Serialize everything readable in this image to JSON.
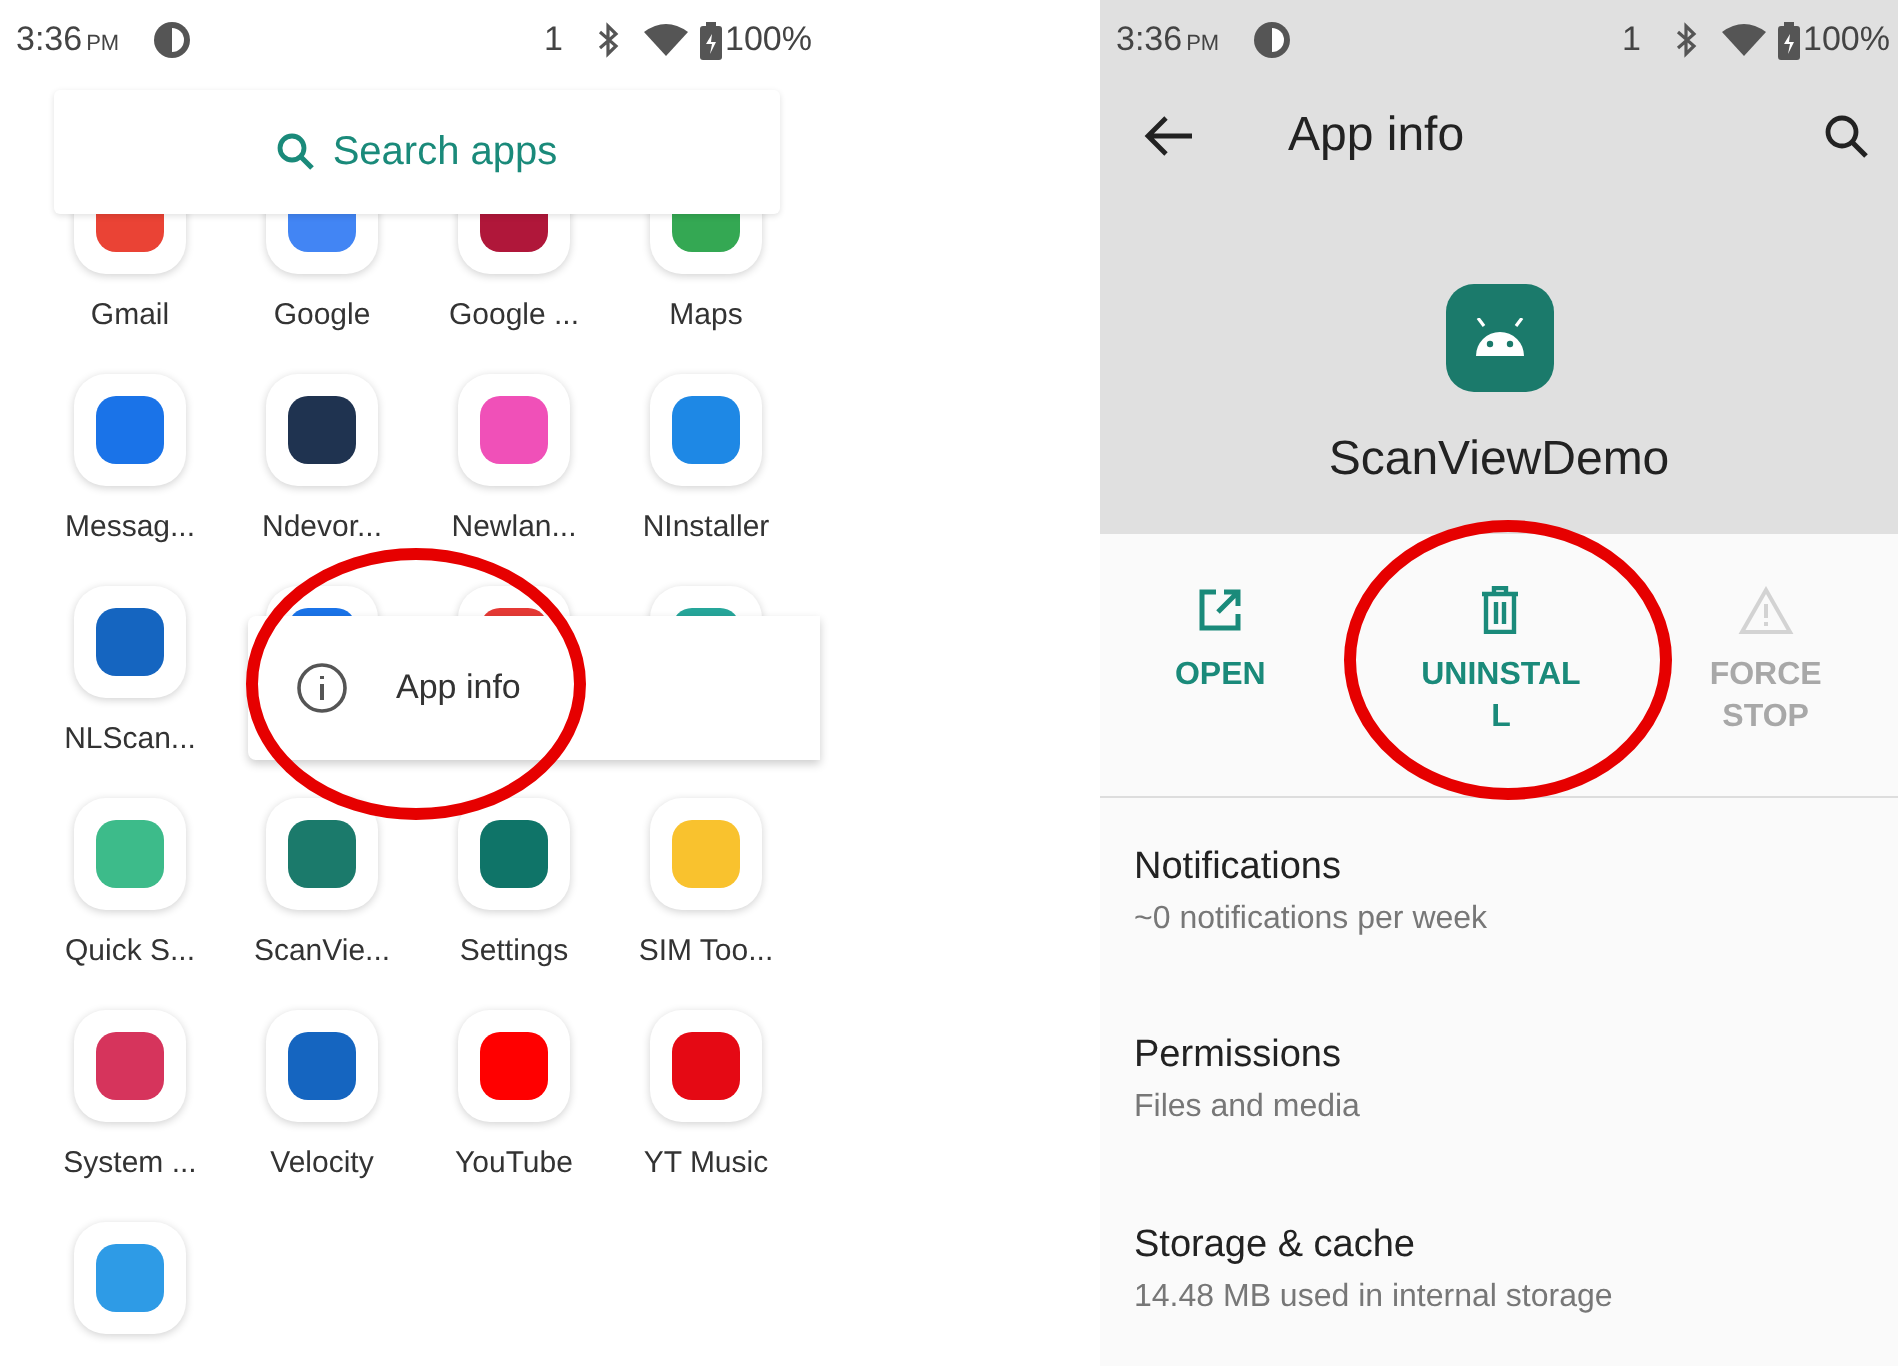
{
  "left_screen": {
    "status_bar": {
      "time": "3:36",
      "period": "PM",
      "sim_slot": "1",
      "battery": "100%"
    },
    "search": {
      "placeholder": "Search apps"
    },
    "apps": [
      {
        "label": "Gmail",
        "color": "#ea4335"
      },
      {
        "label": "Google",
        "color": "#4285f4"
      },
      {
        "label": "Google ...",
        "color": "#b0173a"
      },
      {
        "label": "Maps",
        "color": "#34a853"
      },
      {
        "label": "Messag...",
        "color": "#1a73e8"
      },
      {
        "label": "Ndevor...",
        "color": "#1f3350"
      },
      {
        "label": "Newlan...",
        "color": "#f050b8"
      },
      {
        "label": "NInstaller",
        "color": "#1e88e5"
      },
      {
        "label": "NLScan...",
        "color": "#1565c0"
      },
      {
        "color": "#1a73e8"
      },
      {
        "color": "#e53935"
      },
      {
        "color": "#26a69a"
      },
      {
        "label": "Quick S...",
        "color": "#3dbb8a"
      },
      {
        "label": "ScanVie...",
        "color": "#1b7a6b"
      },
      {
        "label": "Settings",
        "color": "#0f7468"
      },
      {
        "label": "SIM Too...",
        "color": "#f9c22e"
      },
      {
        "label": "System ...",
        "color": "#d6345c"
      },
      {
        "label": "Velocity",
        "color": "#1565c0"
      },
      {
        "label": "YouTube",
        "color": "#ff0000"
      },
      {
        "label": "YT Music",
        "color": "#e50914"
      },
      {
        "color": "#2e9be6"
      }
    ],
    "popup": {
      "item": "App info"
    }
  },
  "right_screen": {
    "status_bar": {
      "time": "3:36",
      "period": "PM",
      "sim_slot": "1",
      "battery": "100%"
    },
    "toolbar": {
      "title": "App info"
    },
    "app_name": "ScanViewDemo",
    "actions": [
      {
        "kind": "open",
        "label": "OPEN",
        "disabled": false
      },
      {
        "kind": "uninstall",
        "label": "UNINSTALL",
        "disabled": false
      },
      {
        "kind": "force_stop",
        "label": "FORCE STOP",
        "disabled": true
      }
    ],
    "settings": [
      {
        "title": "Notifications",
        "summary": "~0 notifications per week"
      },
      {
        "title": "Permissions",
        "summary": "Files and media"
      },
      {
        "title": "Storage & cache",
        "summary": "14.48 MB used in internal storage"
      }
    ]
  }
}
